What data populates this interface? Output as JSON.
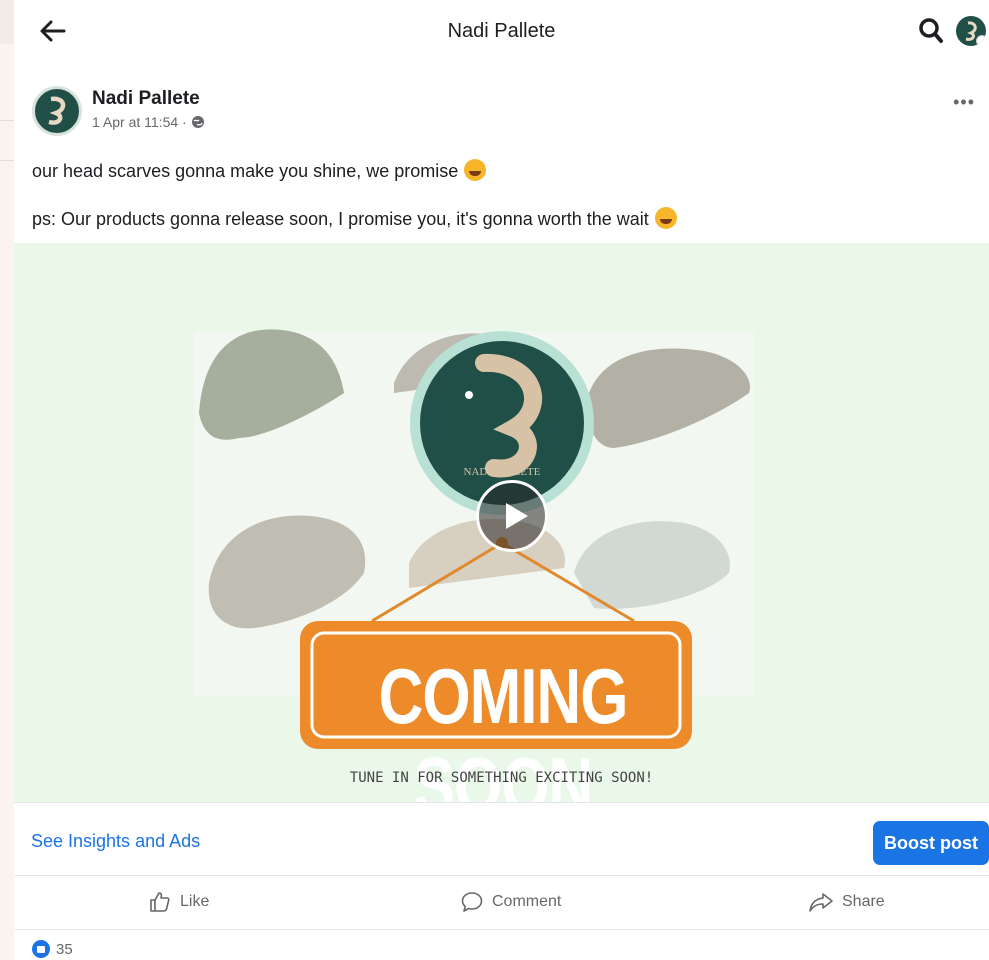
{
  "header": {
    "title": "Nadi Pallete",
    "back_icon": "arrow-left-icon",
    "search_icon": "search-icon"
  },
  "post": {
    "author": "Nadi Pallete",
    "timestamp": "1 Apr at 11:54 ·",
    "privacy_icon": "globe-icon",
    "line1": "our head scarves gonna make you shine, we promise",
    "line2": "ps: Our products gonna release soon, I promise you, it's gonna worth the wait",
    "media": {
      "headline": "COMING SOON",
      "tagline": "TUNE IN FOR SOMETHING EXCITING SOON!",
      "logo_text": "NADI PALLETE",
      "play_icon": "play-icon"
    }
  },
  "insights": {
    "link": "See Insights and Ads",
    "boost_label": "Boost post"
  },
  "actions": {
    "like": "Like",
    "comment": "Comment",
    "share": "Share"
  },
  "reactions": {
    "count": "35"
  },
  "colors": {
    "accent": "#1b74e4",
    "media_bg": "#eaf8e9",
    "banner_orange": "#ed8b2a",
    "logo_green": "#1f4f47"
  }
}
